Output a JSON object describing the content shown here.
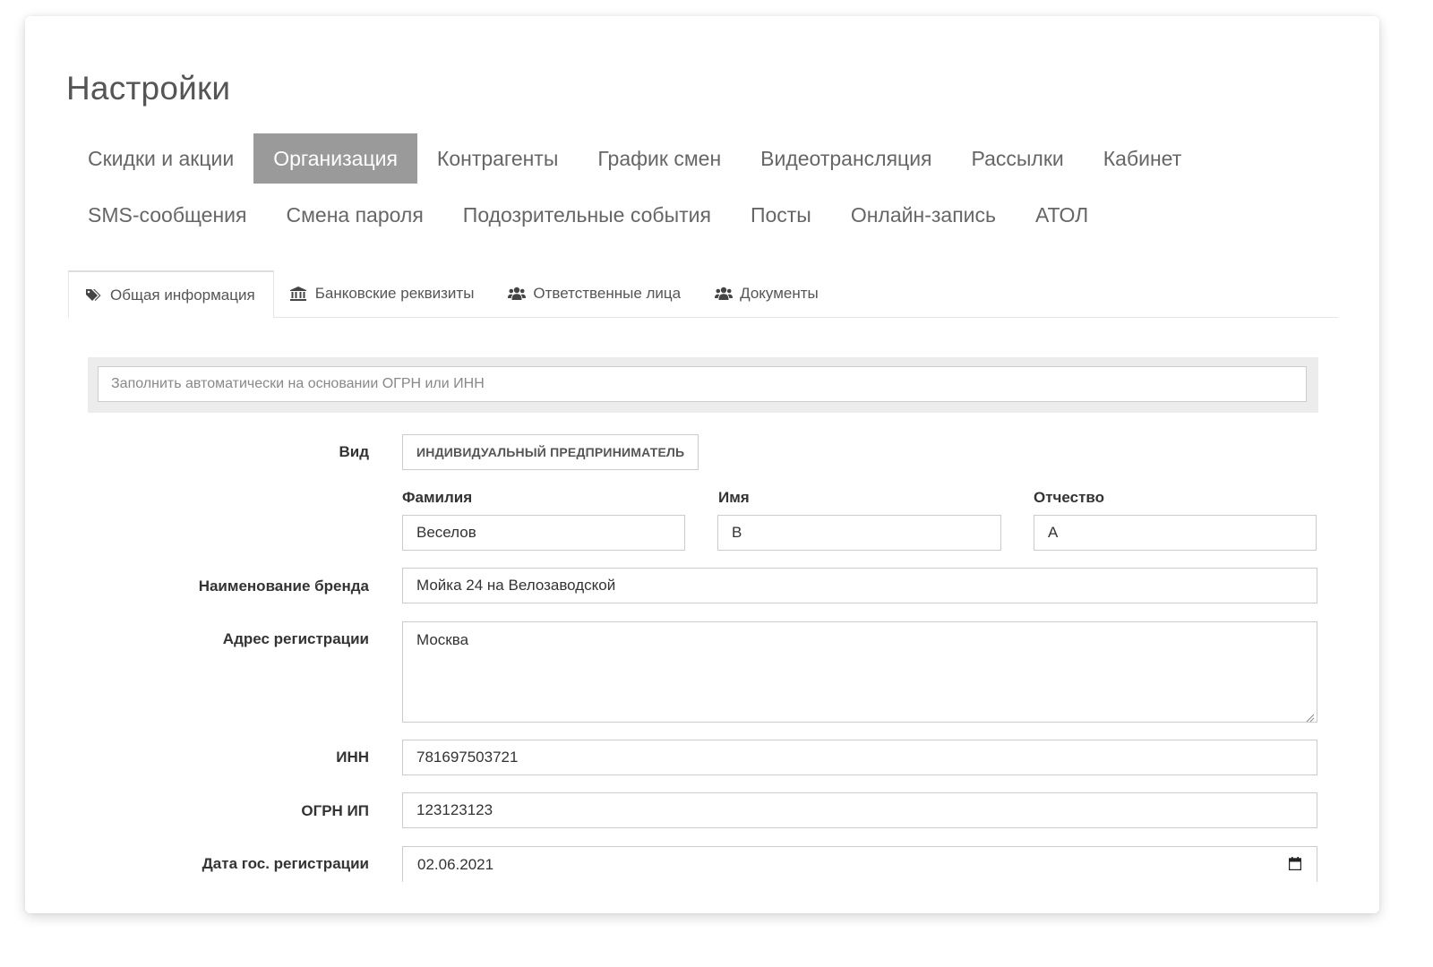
{
  "page": {
    "title": "Настройки"
  },
  "main_nav": {
    "row1": [
      "Скидки и акции",
      "Организация",
      "Контрагенты",
      "График смен",
      "Видеотрансляция",
      "Рассылки",
      "Кабинет"
    ],
    "row2": [
      "SMS-сообщения",
      "Смена пароля",
      "Подозрительные события",
      "Посты",
      "Онлайн-запись",
      "АТОЛ"
    ],
    "active": "Организация"
  },
  "subtabs": [
    {
      "label": "Общая информация",
      "icon": "tags-icon",
      "active": true
    },
    {
      "label": "Банковские реквизиты",
      "icon": "bank-icon",
      "active": false
    },
    {
      "label": "Ответственные лица",
      "icon": "users-icon",
      "active": false
    },
    {
      "label": "Документы",
      "icon": "users-icon",
      "active": false
    }
  ],
  "autofill": {
    "placeholder": "Заполнить автоматически на основании ОГРН или ИНН",
    "value": ""
  },
  "form": {
    "type_label": "Вид",
    "type_value": "Индивидуальный предприниматель",
    "surname_label": "Фамилия",
    "surname_value": "Веселов",
    "name_label": "Имя",
    "name_value": "В",
    "patronymic_label": "Отчество",
    "patronymic_value": "А",
    "brand_label": "Наименование бренда",
    "brand_value": "Мойка 24 на Велозаводской",
    "address_label": "Адрес регистрации",
    "address_value": "Москва",
    "inn_label": "ИНН",
    "inn_value": "781697503721",
    "ogrn_label": "ОГРН ИП",
    "ogrn_value": "123123123",
    "reg_date_label": "Дата гос. регистрации",
    "reg_date_value": "02.06.2021"
  },
  "colors": {
    "active_tab_bg": "#9a9a9a",
    "active_tab_text": "#ffffff",
    "nav_text": "#666666",
    "field_border": "#cccccc",
    "autofill_bg": "#ececec"
  }
}
